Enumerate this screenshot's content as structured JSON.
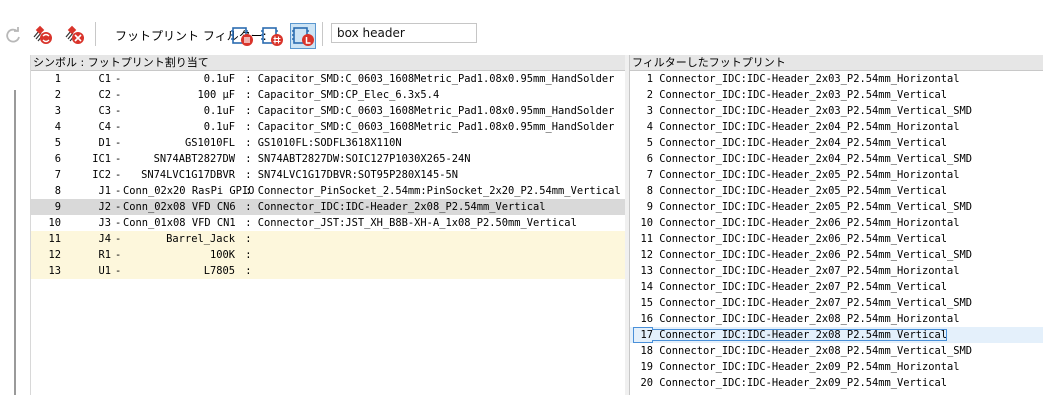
{
  "toolbar": {
    "filter_label": "フットプリント フィルター:",
    "search_value": "box header",
    "icons": [
      "redo-icon",
      "auto-assign-icon",
      "clear-assignments-icon",
      "filter-by-keywords-icon",
      "filter-by-pin-count-icon",
      "filter-by-library-icon"
    ]
  },
  "symbols_panel": {
    "title": "シンボル : フットプリント割り当て",
    "rows": [
      {
        "num": "1",
        "ref": "C1",
        "value": "0.1uF",
        "sep": " : ",
        "footprint": "Capacitor_SMD:C_0603_1608Metric_Pad1.08x0.95mm_HandSolder",
        "state": "assigned"
      },
      {
        "num": "2",
        "ref": "C2",
        "value": "100 µF",
        "sep": " : ",
        "footprint": "Capacitor_SMD:CP_Elec_6.3x5.4",
        "state": "assigned"
      },
      {
        "num": "3",
        "ref": "C3",
        "value": "0.1uF",
        "sep": " : ",
        "footprint": "Capacitor_SMD:C_0603_1608Metric_Pad1.08x0.95mm_HandSolder",
        "state": "assigned"
      },
      {
        "num": "4",
        "ref": "C4",
        "value": "0.1uF",
        "sep": " : ",
        "footprint": "Capacitor_SMD:C_0603_1608Metric_Pad1.08x0.95mm_HandSolder",
        "state": "assigned"
      },
      {
        "num": "5",
        "ref": "D1",
        "value": "GS1010FL",
        "sep": " : ",
        "footprint": "GS1010FL:SODFL3618X110N",
        "state": "assigned"
      },
      {
        "num": "6",
        "ref": "IC1",
        "value": "SN74ABT2827DW",
        "sep": " : ",
        "footprint": "SN74ABT2827DW:SOIC127P1030X265-24N",
        "state": "assigned"
      },
      {
        "num": "7",
        "ref": "IC2",
        "value": "SN74LVC1G17DBVR",
        "sep": " : ",
        "footprint": "SN74LVC1G17DBVR:SOT95P280X145-5N",
        "state": "assigned"
      },
      {
        "num": "8",
        "ref": "J1",
        "value": "Conn_02x20 RasPi GPIO",
        "sep": " : ",
        "footprint": "Connector_PinSocket_2.54mm:PinSocket_2x20_P2.54mm_Vertical",
        "state": "assigned"
      },
      {
        "num": "9",
        "ref": "J2",
        "value": "Conn_02x08 VFD CN6",
        "sep": " : ",
        "footprint": "Connector_IDC:IDC-Header_2x08_P2.54mm_Vertical",
        "state": "selected"
      },
      {
        "num": "10",
        "ref": "J3",
        "value": "Conn_01x08 VFD CN1",
        "sep": " : ",
        "footprint": "Connector_JST:JST_XH_B8B-XH-A_1x08_P2.50mm_Vertical",
        "state": "assigned"
      },
      {
        "num": "11",
        "ref": "J4",
        "value": "Barrel_Jack",
        "sep": " :",
        "footprint": "",
        "state": "unassigned"
      },
      {
        "num": "12",
        "ref": "R1",
        "value": "100K",
        "sep": " :",
        "footprint": "",
        "state": "unassigned"
      },
      {
        "num": "13",
        "ref": "U1",
        "value": "L7805",
        "sep": " :",
        "footprint": "",
        "state": "unassigned"
      }
    ]
  },
  "footprints_panel": {
    "title": "フィルターしたフットプリント",
    "rows": [
      {
        "num": "1",
        "name": "Connector_IDC:IDC-Header_2x03_P2.54mm_Horizontal"
      },
      {
        "num": "2",
        "name": "Connector_IDC:IDC-Header_2x03_P2.54mm_Vertical"
      },
      {
        "num": "3",
        "name": "Connector_IDC:IDC-Header_2x03_P2.54mm_Vertical_SMD"
      },
      {
        "num": "4",
        "name": "Connector_IDC:IDC-Header_2x04_P2.54mm_Horizontal"
      },
      {
        "num": "5",
        "name": "Connector_IDC:IDC-Header_2x04_P2.54mm_Vertical"
      },
      {
        "num": "6",
        "name": "Connector_IDC:IDC-Header_2x04_P2.54mm_Vertical_SMD"
      },
      {
        "num": "7",
        "name": "Connector_IDC:IDC-Header_2x05_P2.54mm_Horizontal"
      },
      {
        "num": "8",
        "name": "Connector_IDC:IDC-Header_2x05_P2.54mm_Vertical"
      },
      {
        "num": "9",
        "name": "Connector_IDC:IDC-Header_2x05_P2.54mm_Vertical_SMD"
      },
      {
        "num": "10",
        "name": "Connector_IDC:IDC-Header_2x06_P2.54mm_Horizontal"
      },
      {
        "num": "11",
        "name": "Connector_IDC:IDC-Header_2x06_P2.54mm_Vertical"
      },
      {
        "num": "12",
        "name": "Connector_IDC:IDC-Header_2x06_P2.54mm_Vertical_SMD"
      },
      {
        "num": "13",
        "name": "Connector_IDC:IDC-Header_2x07_P2.54mm_Horizontal"
      },
      {
        "num": "14",
        "name": "Connector_IDC:IDC-Header_2x07_P2.54mm_Vertical"
      },
      {
        "num": "15",
        "name": "Connector_IDC:IDC-Header_2x07_P2.54mm_Vertical_SMD"
      },
      {
        "num": "16",
        "name": "Connector_IDC:IDC-Header_2x08_P2.54mm_Horizontal"
      },
      {
        "num": "17",
        "name": "Connector_IDC:IDC-Header_2x08_P2.54mm_Vertical",
        "selected": true
      },
      {
        "num": "18",
        "name": "Connector_IDC:IDC-Header_2x08_P2.54mm_Vertical_SMD"
      },
      {
        "num": "19",
        "name": "Connector_IDC:IDC-Header_2x09_P2.54mm_Horizontal"
      },
      {
        "num": "20",
        "name": "Connector_IDC:IDC-Header_2x09_P2.54mm_Vertical"
      }
    ]
  },
  "colors": {
    "selected_row": "#d9d9d9",
    "unassigned_row": "#fdf7dc",
    "selection_outline": "#4a90d9",
    "accent_red": "#d9342b",
    "accent_blue": "#2b6cb0"
  }
}
